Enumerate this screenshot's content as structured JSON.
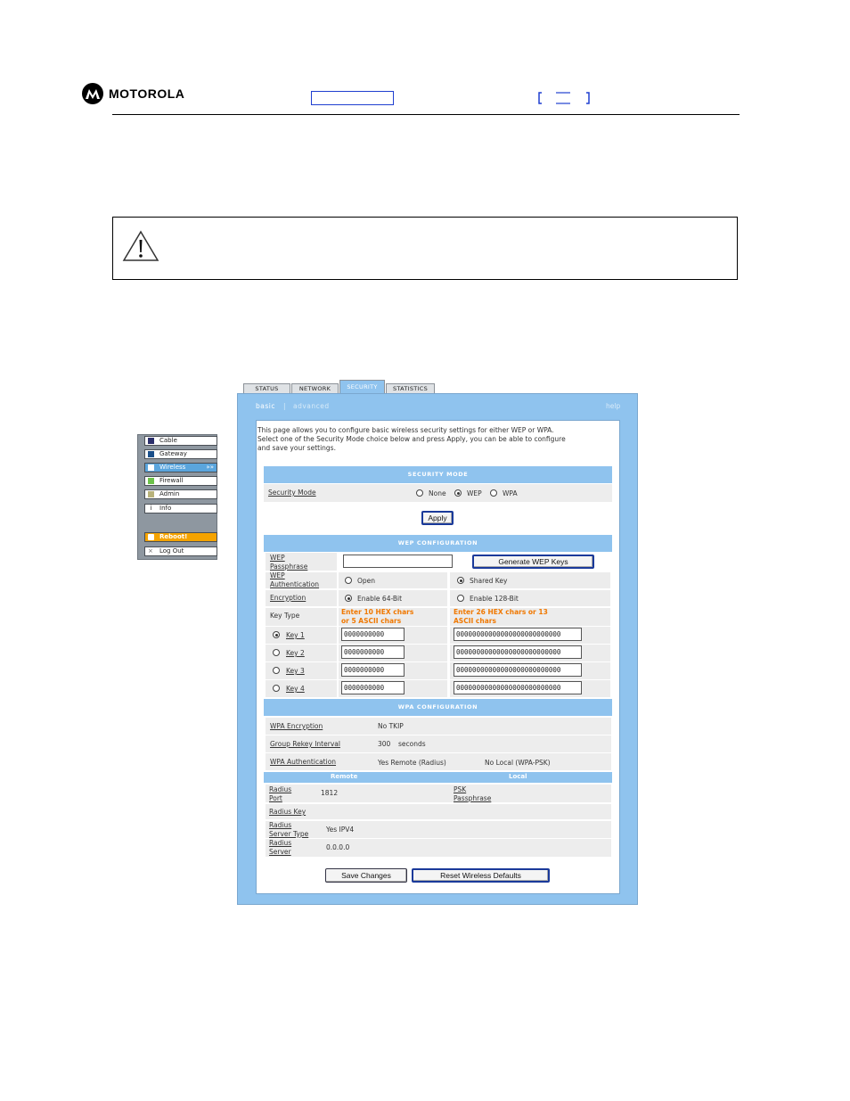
{
  "header": {
    "brand": "MOTOROLA",
    "logo_icon": "motorola-batwing-logo"
  },
  "caution": {
    "icon": "warning-triangle-icon"
  },
  "side_menu": {
    "items": [
      {
        "label": "Cable",
        "icon": "square-icon",
        "color": "#2b2f6b"
      },
      {
        "label": "Gateway",
        "icon": "square-icon",
        "color": "#1a4f8a"
      },
      {
        "label": "Wireless",
        "icon": "square-icon",
        "color": "#ffffff",
        "active": true,
        "arrow": "»»"
      },
      {
        "label": "Firewall",
        "icon": "square-icon",
        "color": "#6cc24a"
      },
      {
        "label": "Admin",
        "icon": "square-icon",
        "color": "#b8b27a"
      },
      {
        "label": "Info",
        "icon": "info-icon",
        "glyph": "i"
      }
    ],
    "reboot": "Reboot!",
    "logout": "Log Out"
  },
  "tabs": [
    "STATUS",
    "NETWORK",
    "SECURITY",
    "STATISTICS"
  ],
  "active_tab": "SECURITY",
  "subnav": {
    "basic": "basic",
    "separator": "|",
    "advanced": "advanced",
    "help": "help"
  },
  "intro": [
    "This page allows you to configure basic wireless security settings for either WEP or WPA.",
    "Select one of the Security Mode choice below and press Apply, you can be able to configure",
    "and save your settings."
  ],
  "security_mode": {
    "heading": "SECURITY MODE",
    "label": "Security Mode",
    "options": [
      "None",
      "WEP",
      "WPA"
    ],
    "selected": "WEP",
    "apply": "Apply"
  },
  "wep": {
    "heading": "WEP CONFIGURATION",
    "passphrase_label": [
      "WEP",
      "Passphrase"
    ],
    "passphrase_value": "",
    "generate_button": "Generate WEP Keys",
    "auth_label": [
      "WEP",
      "Authentication"
    ],
    "auth_options": [
      "Open",
      "Shared Key"
    ],
    "auth_selected": "Shared Key",
    "encryption_label": "Encryption",
    "enc_options": [
      "Enable 64-Bit",
      "Enable 128-Bit"
    ],
    "enc_selected": "Enable 64-Bit",
    "key_type_label": "Key Type",
    "hint_64": [
      "Enter 10 HEX chars",
      "or 5 ASCII chars"
    ],
    "hint_128": [
      "Enter 26 HEX chars or 13",
      "ASCII chars"
    ],
    "keys": [
      {
        "label": "Key 1",
        "short": "0000000000",
        "long": "00000000000000000000000000",
        "selected": true
      },
      {
        "label": "Key 2",
        "short": "0000000000",
        "long": "00000000000000000000000000",
        "selected": false
      },
      {
        "label": "Key 3",
        "short": "0000000000",
        "long": "00000000000000000000000000",
        "selected": false
      },
      {
        "label": "Key 4",
        "short": "0000000000",
        "long": "00000000000000000000000000",
        "selected": false
      }
    ]
  },
  "wpa": {
    "heading": "WPA CONFIGURATION",
    "encryption_label": "WPA Encryption",
    "encryption_value": "No TKIP",
    "rekey_label": "Group Rekey Interval",
    "rekey_value": "300",
    "rekey_unit": "seconds",
    "auth_label": "WPA Authentication",
    "auth_remote": "Yes Remote (Radius)",
    "auth_local": "No Local (WPA-PSK)",
    "remote_heading": "Remote",
    "local_heading": "Local",
    "radius_port_label": [
      "Radius",
      "Port"
    ],
    "radius_port_value": "1812",
    "psk_label": [
      "PSK",
      "Passphrase"
    ],
    "radius_key_label": "Radius Key",
    "server_type_label": [
      "Radius",
      "Server Type"
    ],
    "server_type_value": "Yes IPV4",
    "server_label": [
      "Radius",
      "Server"
    ],
    "server_value": "0.0.0.0"
  },
  "buttons": {
    "save": "Save Changes",
    "reset": "Reset Wireless Defaults"
  }
}
